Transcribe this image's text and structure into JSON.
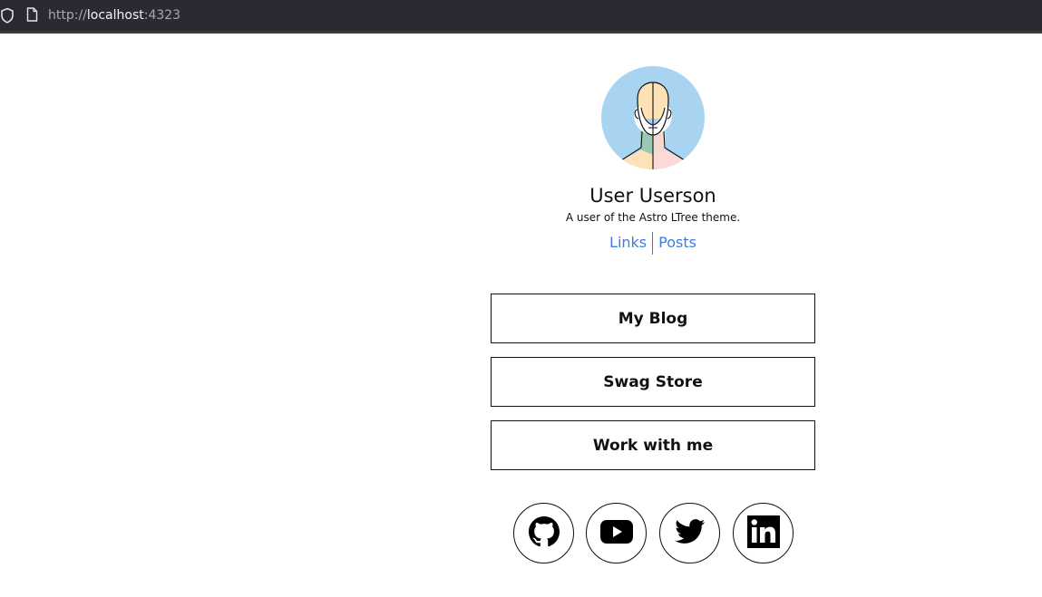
{
  "browser": {
    "url_scheme": "http://",
    "url_host": "localhost",
    "url_port": ":4323"
  },
  "profile": {
    "name": "User Userson",
    "bio": "A user of the Astro LTree theme."
  },
  "nav": {
    "links_label": "Links",
    "posts_label": "Posts"
  },
  "links": [
    {
      "label": "My Blog"
    },
    {
      "label": "Swag Store"
    },
    {
      "label": "Work with me"
    }
  ],
  "social_icons": [
    "github-icon",
    "youtube-icon",
    "twitter-icon",
    "linkedin-icon"
  ],
  "colors": {
    "accent": "#3b7ddd",
    "avatar_bg": "#a8d4f2",
    "toolbar_bg": "#2b2a33"
  }
}
